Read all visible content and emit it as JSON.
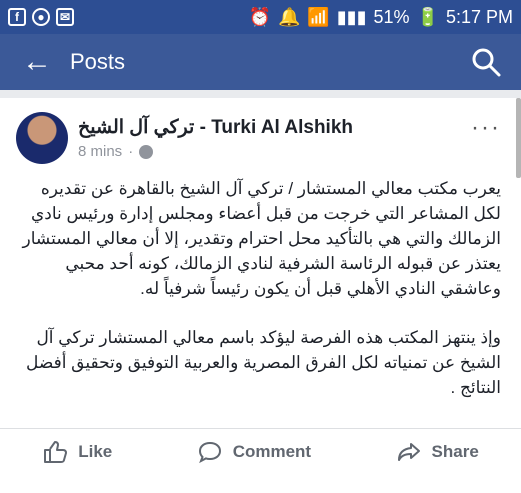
{
  "status_bar": {
    "icons": [
      "facebook-icon",
      "circle-icon",
      "mail-icon",
      "alarm-icon",
      "notification-icon",
      "wifi-icon",
      "data-icon",
      "signal-icon"
    ],
    "battery": "51%",
    "time": "5:17 PM"
  },
  "app_bar": {
    "title": "Posts",
    "back_icon": "back-arrow-icon",
    "search_icon": "search-icon"
  },
  "post": {
    "author": "تركي آل الشيخ - Turki Al Alshikh",
    "time": "8 mins",
    "privacy_icon": "globe-icon",
    "paragraph1": "يعرب مكتب معالي المستشار / تركي آل الشيخ بالقاهرة عن تقديره لكل المشاعر التي خرجت من قبل أعضاء ومجلس إدارة  ورئيس نادي الزمالك والتي هي بالتأكيد محل احترام وتقدير، إلا أن معالي المستشار يعتذر عن قبوله الرئاسة الشرفية لنادي الزمالك، كونه أحد محبي وعاشقي النادي الأهلي قبل أن يكون  رئيساً شرفياً له.",
    "paragraph2": "وإذ  ينتهز المكتب  هذه الفرصة ليؤكد باسم معالي المستشار تركي آل الشيخ عن تمنياته  لكل الفرق المصرية والعربية التوفيق وتحقيق أفضل النتائج ."
  },
  "actions": {
    "like": "Like",
    "comment": "Comment",
    "share": "Share"
  },
  "colors": {
    "status_bar": "#2d4e93",
    "app_bar": "#3b5998",
    "background": "#e9ebee"
  }
}
